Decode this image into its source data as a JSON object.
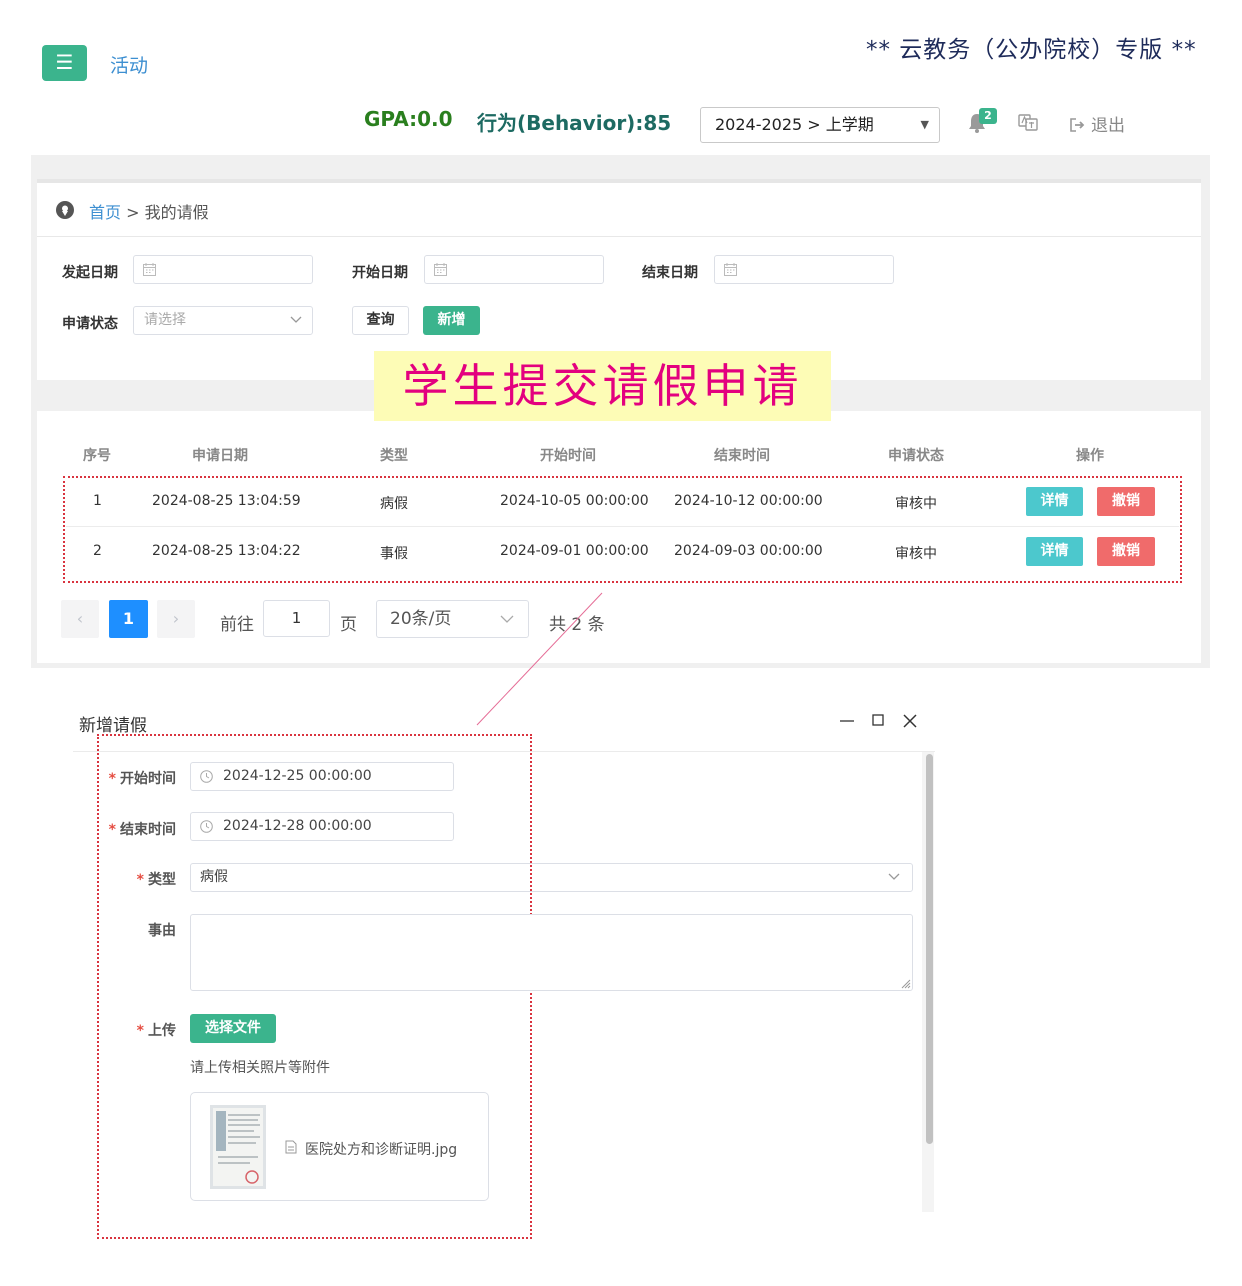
{
  "header": {
    "menu_icon": "☰",
    "nav_link": "活动",
    "brand": "** 云教务（公办院校）专版 **",
    "gpa": "GPA:0.0",
    "behavior": "行为(Behavior):85",
    "semester": "2024-2025 > 上学期",
    "semester_caret": "▼",
    "notification_count": "2",
    "logout": "退出"
  },
  "breadcrumb": {
    "home": "首页",
    "separator": ">",
    "current": "我的请假"
  },
  "filters": {
    "start_label": "发起日期",
    "begin_label": "开始日期",
    "end_label": "结束日期",
    "status_label": "申请状态",
    "status_placeholder": "请选择",
    "query_button": "查询",
    "add_button": "新增"
  },
  "callout": "学生提交请假申请",
  "table": {
    "columns": [
      "序号",
      "申请日期",
      "类型",
      "开始时间",
      "结束时间",
      "申请状态",
      "操作"
    ],
    "rows": [
      {
        "no": "1",
        "date": "2024-08-25 13:04:59",
        "type": "病假",
        "start": "2024-10-05 00:00:00",
        "end": "2024-10-12 00:00:00",
        "status": "审核中"
      },
      {
        "no": "2",
        "date": "2024-08-25 13:04:22",
        "type": "事假",
        "start": "2024-09-01 00:00:00",
        "end": "2024-09-03 00:00:00",
        "status": "审核中"
      }
    ],
    "detail_button": "详情",
    "cancel_button": "撤销"
  },
  "pagination": {
    "prev": "‹",
    "current_page": "1",
    "next": "›",
    "goto_label": "前往",
    "goto_value": "1",
    "page_label": "页",
    "page_size": "20条/页",
    "total": "共 2 条"
  },
  "dialog": {
    "title": "新增请假",
    "required_mark": "*",
    "start_label": "开始时间",
    "start_value": "2024-12-25 00:00:00",
    "end_label": "结束时间",
    "end_value": "2024-12-28 00:00:00",
    "type_label": "类型",
    "type_value": "病假",
    "reason_label": "事由",
    "upload_label": "上传",
    "choose_file_button": "选择文件",
    "upload_hint": "请上传相关照片等附件",
    "file_name": "医院处方和诊断证明.jpg"
  },
  "colors": {
    "brand_green": "#3bb48d",
    "link_blue": "#3d8fd1",
    "detail_cyan": "#4cc8cd",
    "cancel_red": "#f06b6b",
    "callout_bg": "#fdfcb6",
    "callout_text": "#e3007f",
    "annotation_red": "#d9343f"
  }
}
